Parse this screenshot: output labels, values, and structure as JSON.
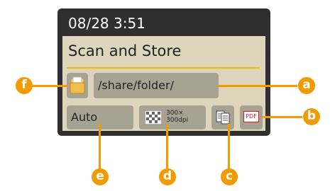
{
  "status": {
    "datetime": "08/28 3:51"
  },
  "title": "Scan and Store",
  "destination": {
    "path": "/share/folder/",
    "icon": "folder-icon"
  },
  "settings": {
    "color_mode": "Auto",
    "resolution_line1": "300×",
    "resolution_line2": "300dpi",
    "resolution_icon": "checkered-pattern-icon",
    "duplex_icon": "two-sided-document-icon",
    "file_format": "PDF"
  },
  "callouts": {
    "a": "a",
    "b": "b",
    "c": "c",
    "d": "d",
    "e": "e",
    "f": "f"
  },
  "colors": {
    "accent": "#f39a00",
    "panel": "#ddd6bc",
    "field": "#a7a392",
    "bezel": "#2f2f2f",
    "rule": "#f0c000",
    "pdf": "#cc2222"
  }
}
